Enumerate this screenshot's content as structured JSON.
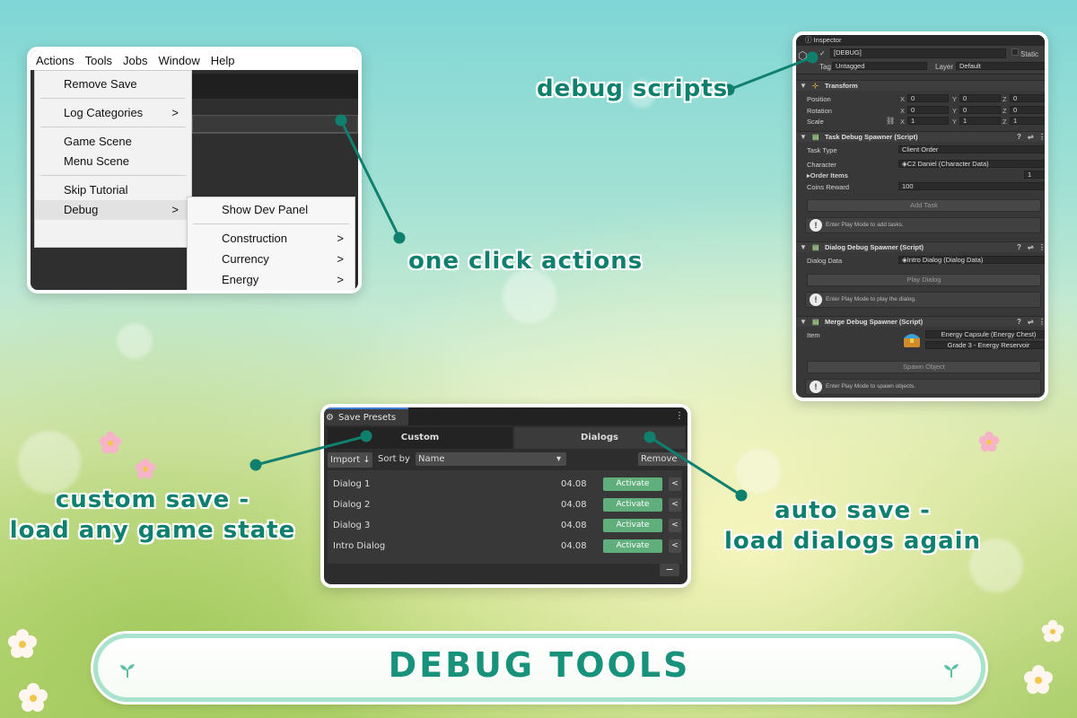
{
  "menu_panel": {
    "menubar": [
      "Actions",
      "Tools",
      "Jobs",
      "Window",
      "Help"
    ],
    "actions_menu": {
      "items": [
        "Remove Save",
        "Log Categories",
        "Game Scene",
        "Menu Scene",
        "Skip Tutorial",
        "Debug"
      ],
      "submenu_arrow": ">"
    },
    "debug_submenu": {
      "items": [
        "Show Dev Panel",
        "Construction",
        "Currency",
        "Energy"
      ]
    }
  },
  "inspector": {
    "tab_title": "Inspector",
    "object_name": "[DEBUG]",
    "static_label": "Static",
    "tag_label": "Tag",
    "tag_value": "Untagged",
    "layer_label": "Layer",
    "layer_value": "Default",
    "transform": {
      "title": "Transform",
      "rows": [
        {
          "label": "Position",
          "x": "0",
          "y": "0",
          "z": "0"
        },
        {
          "label": "Rotation",
          "x": "0",
          "y": "0",
          "z": "0"
        },
        {
          "label": "Scale",
          "x": "1",
          "y": "1",
          "z": "1"
        }
      ],
      "axis_x": "X",
      "axis_y": "Y",
      "axis_z": "Z"
    },
    "task_spawner": {
      "title": "Task Debug Spawner (Script)",
      "task_type_label": "Task Type",
      "task_type_value": "Client Order",
      "character_label": "Character",
      "character_value": "C2 Daniel (Character Data)",
      "order_items_label": "Order Items",
      "order_items_value": "1",
      "coins_label": "Coins Reward",
      "coins_value": "100",
      "button": "Add Task",
      "help": "Enter Play Mode to add tasks."
    },
    "dialog_spawner": {
      "title": "Dialog Debug Spawner (Script)",
      "data_label": "Dialog Data",
      "data_value": "Intro Dialog (Dialog Data)",
      "button": "Play Dialog",
      "help": "Enter Play Mode to play the dialog."
    },
    "merge_spawner": {
      "title": "Merge Debug Spawner (Script)",
      "item_label": "Item",
      "item_value": "Energy Capsule (Energy Chest)",
      "grade_value": "Grade 3 - Energy Reservoir",
      "button": "Spawn Object",
      "help": "Enter Play Mode to spawn objects."
    }
  },
  "save_presets": {
    "window_title": "Save Presets",
    "tabs": [
      "Custom",
      "Dialogs"
    ],
    "import_label": "Import",
    "sort_label": "Sort by",
    "sort_value": "Name",
    "remove_label": "Remove",
    "minus_label": "−",
    "rows": [
      {
        "name": "Dialog 1",
        "date": "04.08",
        "action": "Activate"
      },
      {
        "name": "Dialog 2",
        "date": "04.08",
        "action": "Activate"
      },
      {
        "name": "Dialog 3",
        "date": "04.08",
        "action": "Activate"
      },
      {
        "name": "Intro Dialog",
        "date": "04.08",
        "action": "Activate"
      }
    ]
  },
  "captions": {
    "debug_scripts": "debug scripts",
    "one_click": "one click actions",
    "custom_save_1": "custom save -",
    "custom_save_2": "load any game state",
    "auto_save_1": "auto save -",
    "auto_save_2": "load dialogs again"
  },
  "banner": {
    "title": "DEBUG TOOLS"
  },
  "colors": {
    "caption": "#10806e",
    "banner_text": "#19927c",
    "activate": "#5fae7c",
    "unity_dark": "#383838"
  }
}
